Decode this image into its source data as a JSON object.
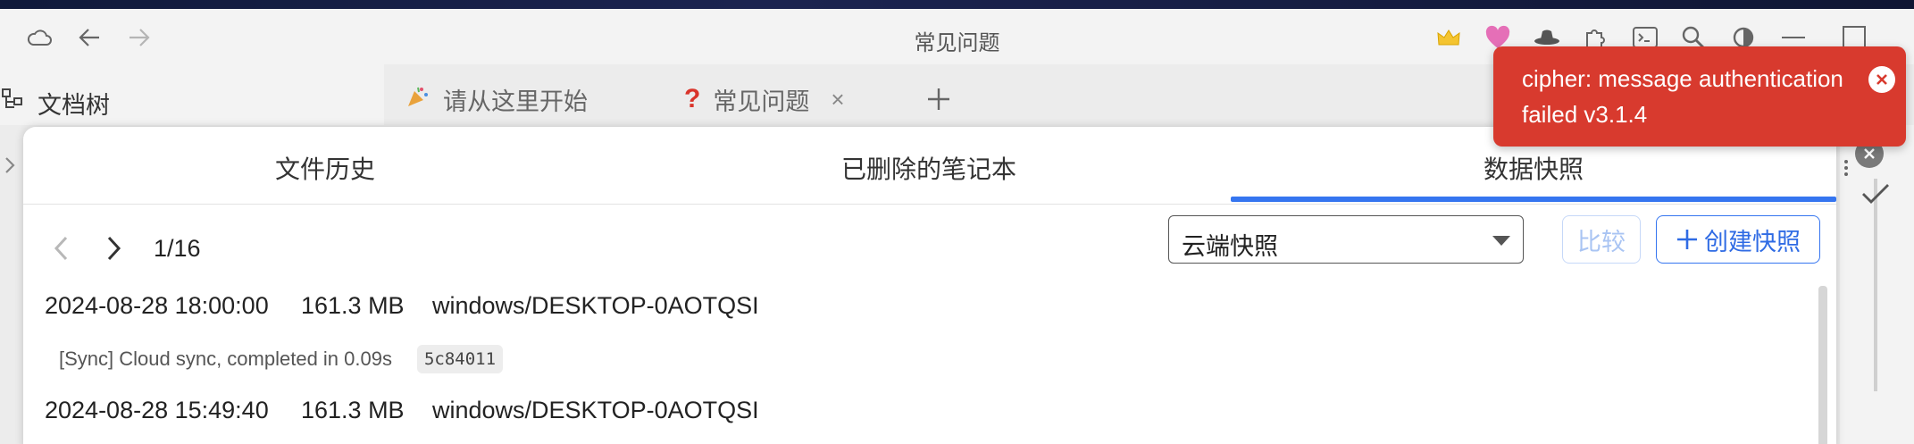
{
  "window": {
    "title": "常见问题"
  },
  "titlebar": {
    "icons": [
      "cloud-icon",
      "back-arrow-icon",
      "forward-arrow-icon",
      "crown-icon",
      "heart-icon",
      "hat-icon",
      "plugin-icon",
      "terminal-icon",
      "search-icon",
      "theme-icon",
      "minimize-icon",
      "maximize-icon"
    ]
  },
  "doctree": {
    "label": "文档树"
  },
  "tabs": [
    {
      "label": "请从这里开始",
      "icon": "party-icon"
    },
    {
      "label": "常见问题",
      "icon": "question-icon",
      "close": "×"
    }
  ],
  "dialog": {
    "tabs": [
      "文件历史",
      "已删除的笔记本",
      "数据快照"
    ],
    "active_tab": "数据快照",
    "pager": "1/16",
    "select": {
      "value": "云端快照"
    },
    "compare_label": "比较",
    "create_label": "创建快照",
    "rows": [
      {
        "date": "2024-08-28 18:00:00",
        "size": "161.3 MB",
        "device": "windows/DESKTOP-0AOTQSI"
      },
      {
        "date": "2024-08-28 15:49:40",
        "size": "161.3 MB",
        "device": "windows/DESKTOP-0AOTQSI"
      }
    ],
    "sync_memo": "[Sync] Cloud sync, completed in 0.09s",
    "hash": "5c84011"
  },
  "toast": {
    "message": "cipher: message authentication failed v3.1.4",
    "color": "#d83a2e"
  },
  "colors": {
    "accent": "#3575f0",
    "toast": "#d83a2e"
  }
}
